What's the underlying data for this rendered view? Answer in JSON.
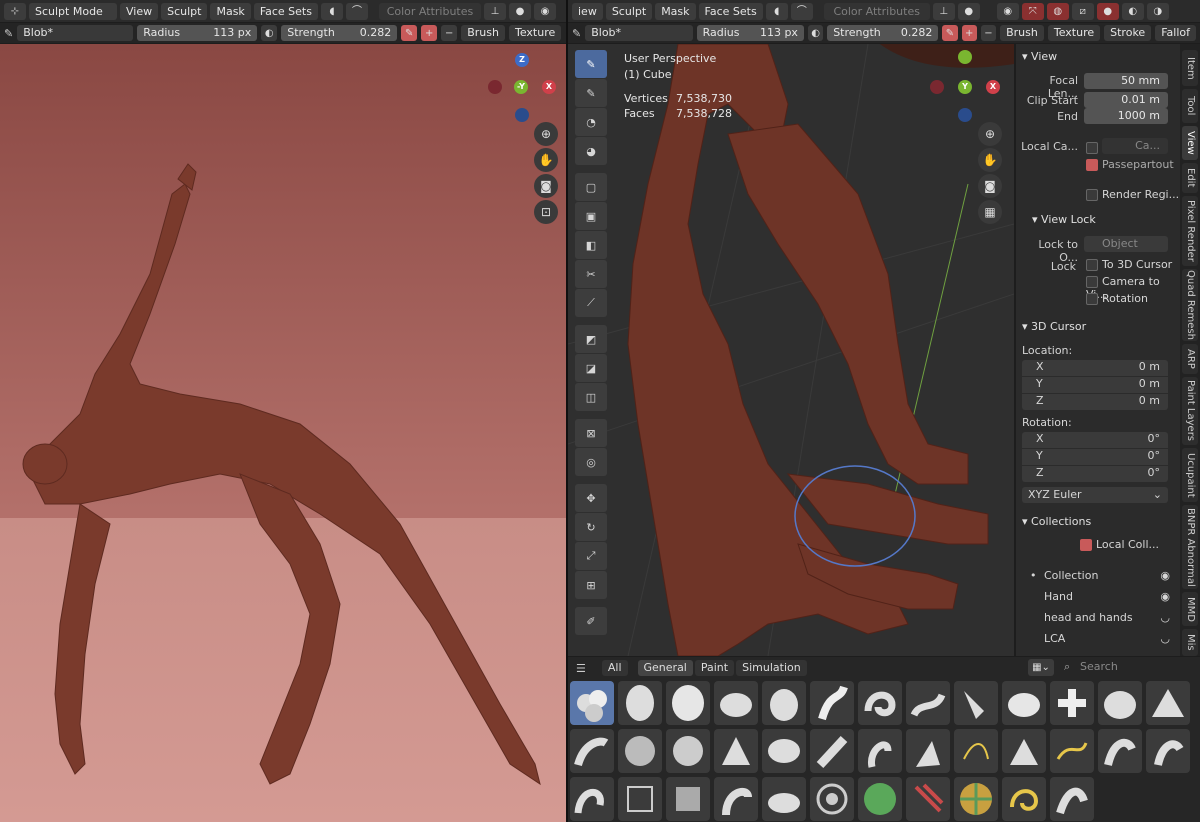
{
  "left_header": {
    "mode": "Sculpt Mode",
    "menus": [
      "View",
      "Sculpt",
      "Mask",
      "Face Sets"
    ],
    "color_attributes": "Color Attributes"
  },
  "left_tool": {
    "brush_name": "Blob*",
    "radius_label": "Radius",
    "radius_value": "113 px",
    "strength_label": "Strength",
    "strength_value": "0.282",
    "brush_menu": "Brush",
    "texture_menu": "Texture"
  },
  "right_header": {
    "menus": [
      "iew",
      "Sculpt",
      "Mask",
      "Face Sets"
    ],
    "color_attributes": "Color Attributes"
  },
  "right_tool": {
    "brush_name": "Blob*",
    "radius_label": "Radius",
    "radius_value": "113 px",
    "strength_label": "Strength",
    "strength_value": "0.282",
    "brush_menu": "Brush",
    "texture_menu": "Texture",
    "stroke_menu": "Stroke",
    "falloff_menu": "Fallof"
  },
  "gizmo": {
    "z": "Z",
    "y": "-Y",
    "x": "X",
    "ry": "Y"
  },
  "overlay": {
    "view_name": "User Perspective",
    "object": "(1) Cube",
    "vertices_label": "Vertices",
    "vertices_value": "7,538,730",
    "faces_label": "Faces",
    "faces_value": "7,538,728"
  },
  "npanel": {
    "view_header": "View",
    "focal_label": "Focal Len...",
    "focal_value": "50 mm",
    "clip_start_label": "Clip Start",
    "clip_start_value": "0.01 m",
    "clip_end_label": "End",
    "clip_end_value": "1000 m",
    "local_camera_label": "Local Ca...",
    "local_camera_value": "Ca...",
    "passepartout": "Passepartout",
    "render_region": "Render Regi...",
    "view_lock_header": "View Lock",
    "lock_to_label": "Lock to O...",
    "lock_to_value": "Object",
    "lock_label": "Lock",
    "to_3d_cursor": "To 3D Cursor",
    "camera_to_view": "Camera to Vi...",
    "rotation_lock": "Rotation",
    "cursor_header": "3D Cursor",
    "location_label": "Location:",
    "loc": [
      {
        "axis": "X",
        "value": "0 m"
      },
      {
        "axis": "Y",
        "value": "0 m"
      },
      {
        "axis": "Z",
        "value": "0 m"
      }
    ],
    "rotation_label": "Rotation:",
    "rot": [
      {
        "axis": "X",
        "value": "0°"
      },
      {
        "axis": "Y",
        "value": "0°"
      },
      {
        "axis": "Z",
        "value": "0°"
      }
    ],
    "rotation_mode": "XYZ Euler",
    "collections_header": "Collections",
    "local_collections": "Local Coll...",
    "collections": [
      "Collection",
      "Hand",
      "head and hands",
      "LCA"
    ]
  },
  "side_tabs": [
    "Item",
    "Tool",
    "View",
    "Edit",
    "Pixel Render",
    "Quad Remesh",
    "ARP",
    "Paint Layers",
    "Ucupaint",
    "BNPR Abnormal",
    "MMD",
    "Mis"
  ],
  "brush_bar": {
    "tabs": [
      "All",
      "General",
      "Paint",
      "Simulation"
    ],
    "search_placeholder": "Search"
  },
  "colors": {
    "accent": "#4c6a9e",
    "viewport_left": "#a8625d",
    "viewport_right": "#2f2f2f",
    "skin": "#7a3a2c",
    "active_check": "#c85a5a"
  }
}
